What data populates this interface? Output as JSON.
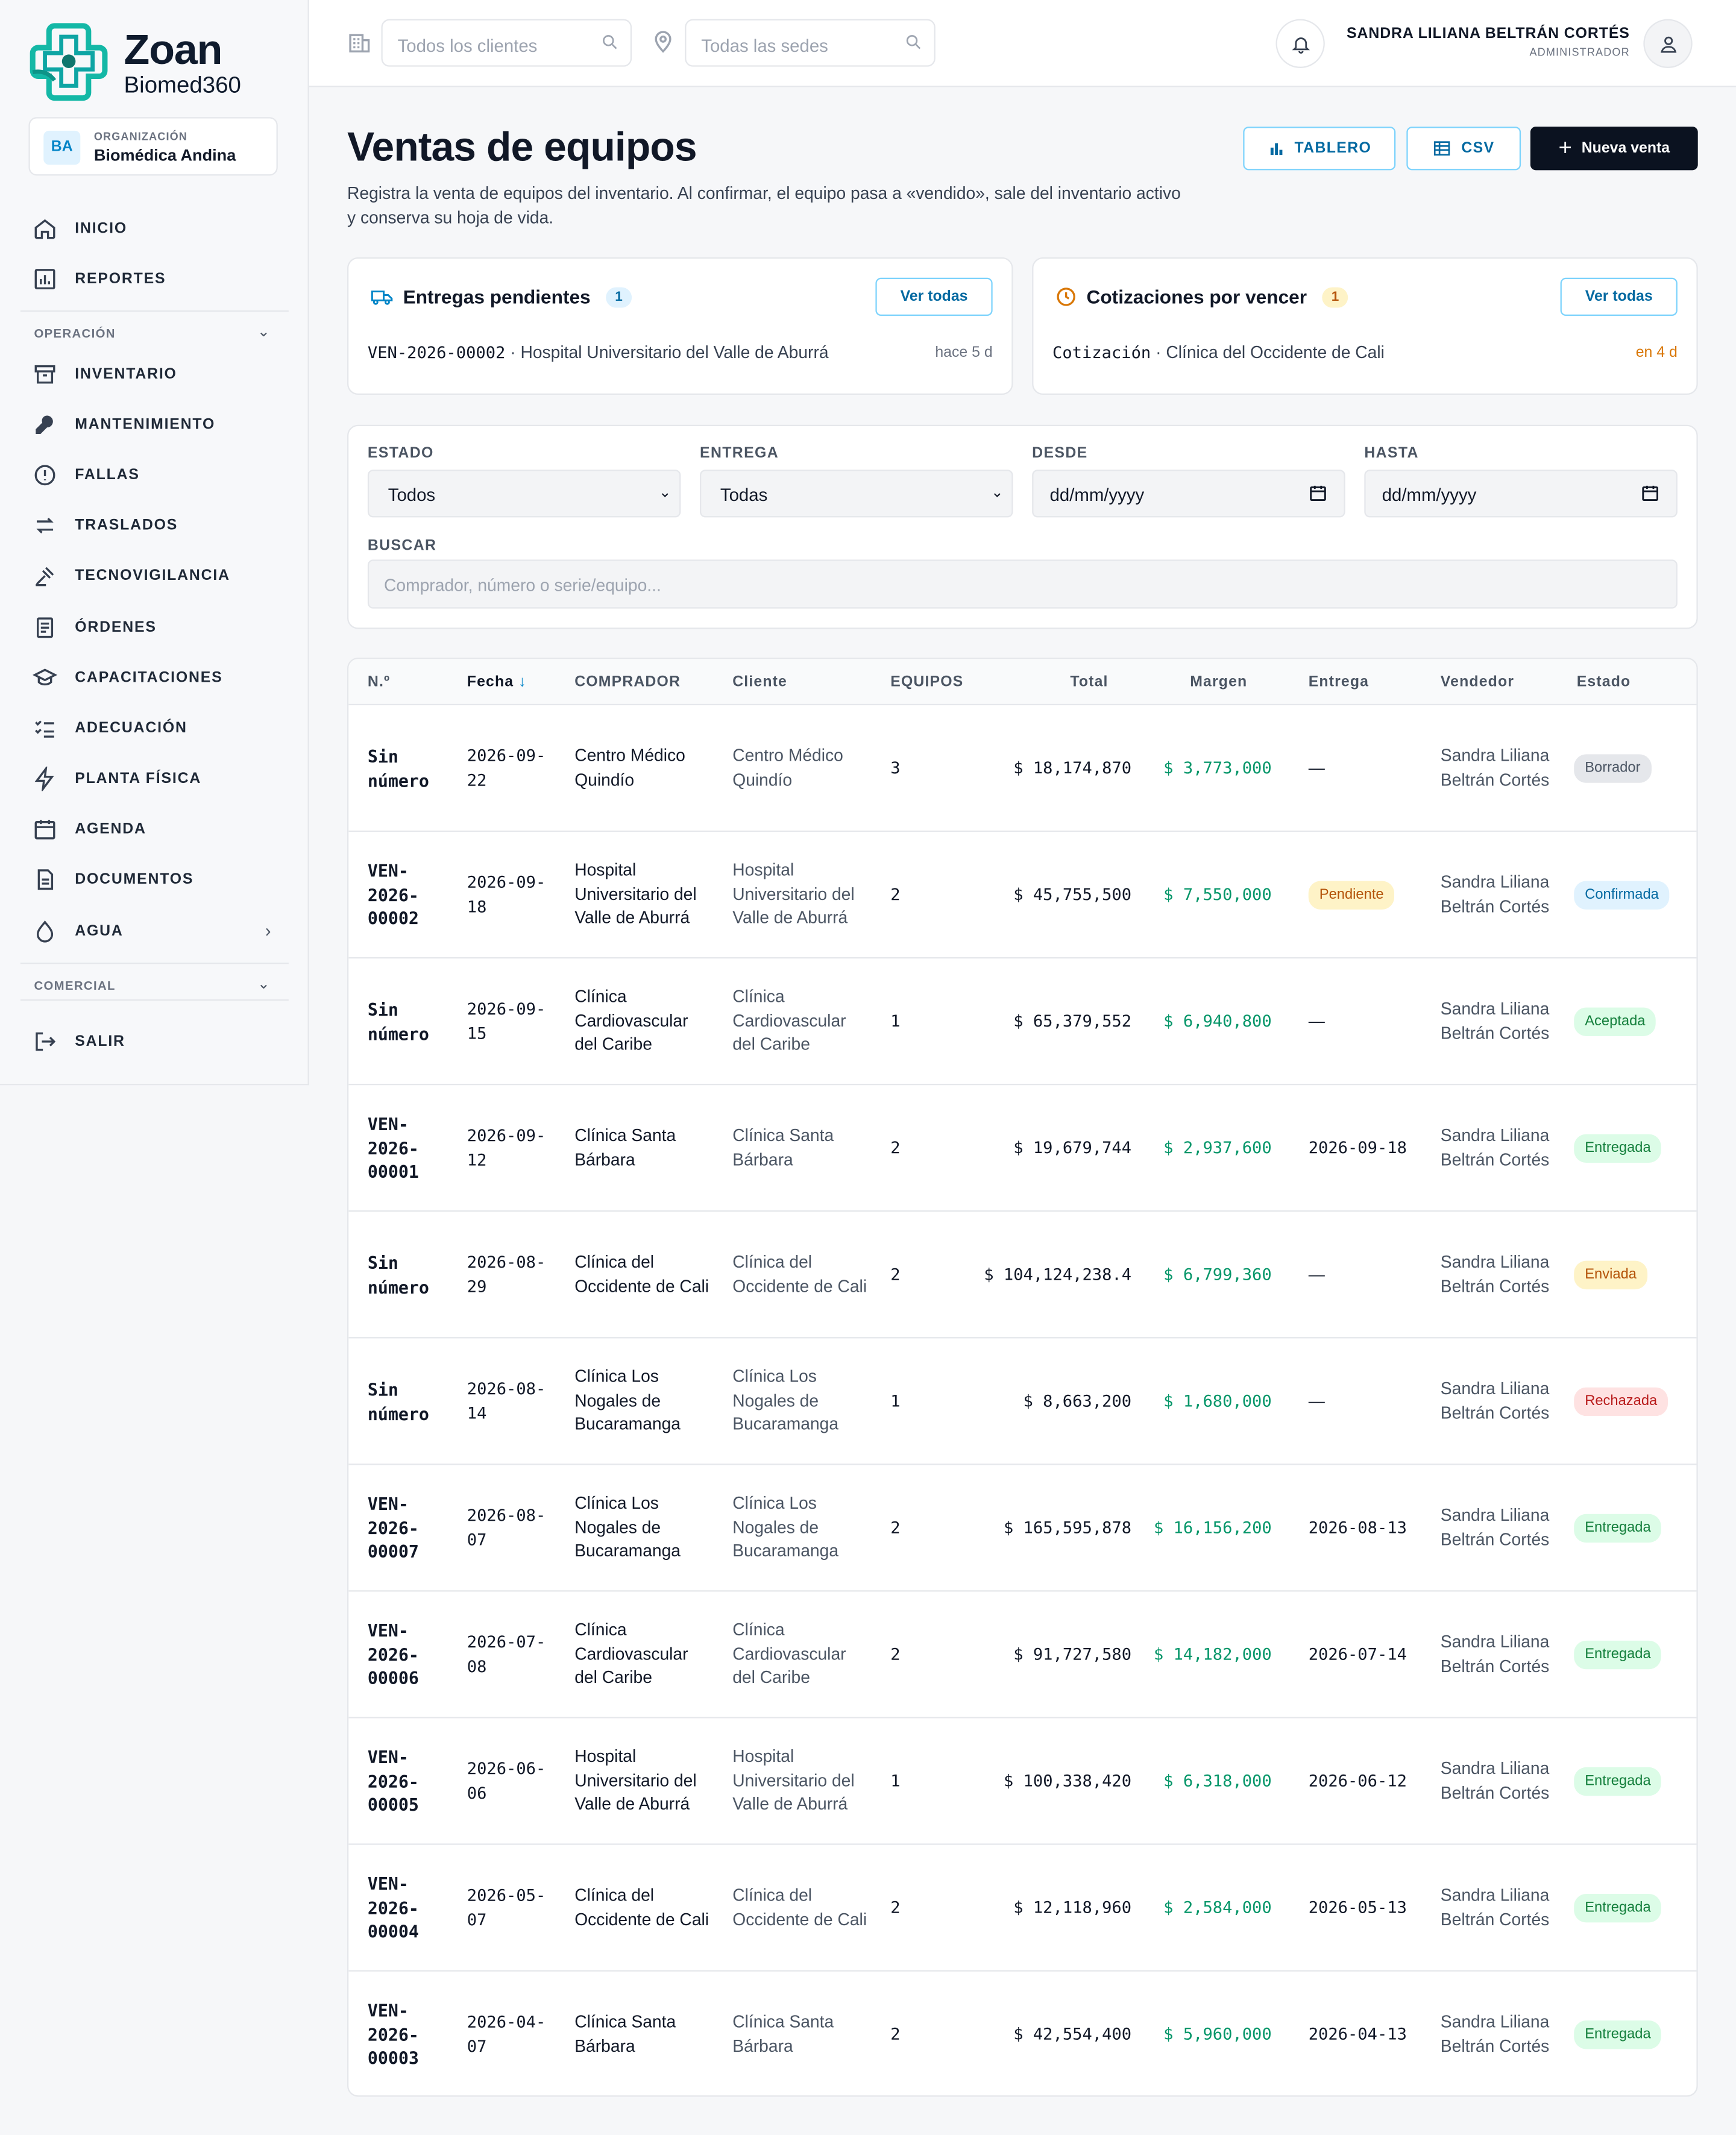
{
  "app": {
    "name": "Zoan",
    "subname": "Biomed360"
  },
  "org": {
    "badge": "BA",
    "label": "ORGANIZACIÓN",
    "name": "Biomédica Andina"
  },
  "nav": {
    "top": [
      {
        "label": "INICIO",
        "icon": "home-icon"
      },
      {
        "label": "REPORTES",
        "icon": "chart-icon"
      }
    ],
    "section_operacion": "OPERACIÓN",
    "operacion": [
      {
        "label": "INVENTARIO",
        "icon": "archive-icon"
      },
      {
        "label": "MANTENIMIENTO",
        "icon": "wrench-icon"
      },
      {
        "label": "FALLAS",
        "icon": "alert-icon"
      },
      {
        "label": "TRASLADOS",
        "icon": "transfer-icon"
      },
      {
        "label": "TECNOVIGILANCIA",
        "icon": "gavel-icon"
      },
      {
        "label": "ÓRDENES",
        "icon": "clipboard-icon"
      },
      {
        "label": "CAPACITACIONES",
        "icon": "graduation-icon"
      },
      {
        "label": "ADECUACIÓN",
        "icon": "checklist-icon"
      },
      {
        "label": "PLANTA FÍSICA",
        "icon": "bolt-icon"
      },
      {
        "label": "AGENDA",
        "icon": "calendar-icon"
      },
      {
        "label": "DOCUMENTOS",
        "icon": "document-icon"
      },
      {
        "label": "AGUA",
        "icon": "drop-icon"
      }
    ],
    "section_comercial": "COMERCIAL",
    "logout": "SALIR"
  },
  "topbar": {
    "clients_placeholder": "Todos los clientes",
    "sites_placeholder": "Todas las sedes",
    "user_name": "SANDRA LILIANA BELTRÁN CORTÉS",
    "user_role": "ADMINISTRADOR"
  },
  "page": {
    "title": "Ventas de equipos",
    "description": "Registra la venta de equipos del inventario. Al confirmar, el equipo pasa a «vendido», sale del inventario activo y conserva su hoja de vida.",
    "btn_tablero": "TABLERO",
    "btn_csv": "CSV",
    "btn_new": "Nueva venta"
  },
  "cards": {
    "entregas": {
      "title": "Entregas pendientes",
      "count": "1",
      "button": "Ver todas",
      "code": "VEN-2026-00002",
      "text": " · Hospital Universitario del Valle de Aburrá",
      "meta": "hace 5 d"
    },
    "cotizaciones": {
      "title": "Cotizaciones por vencer",
      "count": "1",
      "button": "Ver todas",
      "code": "Cotización",
      "text": " · Clínica del Occidente de Cali",
      "meta": "en 4 d"
    }
  },
  "filters": {
    "estado_label": "ESTADO",
    "estado_value": "Todos",
    "entrega_label": "ENTREGA",
    "entrega_value": "Todas",
    "desde_label": "DESDE",
    "desde_value": "dd/mm/yyyy",
    "hasta_label": "HASTA",
    "hasta_value": "dd/mm/yyyy",
    "buscar_label": "BUSCAR",
    "buscar_placeholder": "Comprador, número o serie/equipo..."
  },
  "table": {
    "headers": {
      "num": "N.º",
      "fecha": "Fecha",
      "comprador": "COMPRADOR",
      "cliente": "Cliente",
      "equipos": "EQUIPOS",
      "total": "Total",
      "margen": "Margen",
      "entrega": "Entrega",
      "vendedor": "Vendedor",
      "estado": "Estado"
    },
    "rows": [
      {
        "num": "Sin número",
        "fecha": "2026-09-22",
        "comprador": "Centro Médico Quindío",
        "cliente": "Centro Médico Quindío",
        "equipos": "3",
        "total": "$ 18,174,870",
        "margen": "$ 3,773,000",
        "entrega": "—",
        "vendedor": "Sandra Liliana Beltrán Cortés",
        "estado": "Borrador"
      },
      {
        "num": "VEN-2026-00002",
        "fecha": "2026-09-18",
        "comprador": "Hospital Universitario del Valle de Aburrá",
        "cliente": "Hospital Universitario del Valle de Aburrá",
        "equipos": "2",
        "total": "$ 45,755,500",
        "margen": "$ 7,550,000",
        "entrega": "Pendiente",
        "vendedor": "Sandra Liliana Beltrán Cortés",
        "estado": "Confirmada"
      },
      {
        "num": "Sin número",
        "fecha": "2026-09-15",
        "comprador": "Clínica Cardiovascular del Caribe",
        "cliente": "Clínica Cardiovascular del Caribe",
        "equipos": "1",
        "total": "$ 65,379,552",
        "margen": "$ 6,940,800",
        "entrega": "—",
        "vendedor": "Sandra Liliana Beltrán Cortés",
        "estado": "Aceptada"
      },
      {
        "num": "VEN-2026-00001",
        "fecha": "2026-09-12",
        "comprador": "Clínica Santa Bárbara",
        "cliente": "Clínica Santa Bárbara",
        "equipos": "2",
        "total": "$ 19,679,744",
        "margen": "$ 2,937,600",
        "entrega": "2026-09-18",
        "vendedor": "Sandra Liliana Beltrán Cortés",
        "estado": "Entregada"
      },
      {
        "num": "Sin número",
        "fecha": "2026-08-29",
        "comprador": "Clínica del Occidente de Cali",
        "cliente": "Clínica del Occidente de Cali",
        "equipos": "2",
        "total": "$ 104,124,238.4",
        "margen": "$ 6,799,360",
        "entrega": "—",
        "vendedor": "Sandra Liliana Beltrán Cortés",
        "estado": "Enviada"
      },
      {
        "num": "Sin número",
        "fecha": "2026-08-14",
        "comprador": "Clínica Los Nogales de Bucaramanga",
        "cliente": "Clínica Los Nogales de Bucaramanga",
        "equipos": "1",
        "total": "$ 8,663,200",
        "margen": "$ 1,680,000",
        "entrega": "—",
        "vendedor": "Sandra Liliana Beltrán Cortés",
        "estado": "Rechazada"
      },
      {
        "num": "VEN-2026-00007",
        "fecha": "2026-08-07",
        "comprador": "Clínica Los Nogales de Bucaramanga",
        "cliente": "Clínica Los Nogales de Bucaramanga",
        "equipos": "2",
        "total": "$ 165,595,878",
        "margen": "$ 16,156,200",
        "entrega": "2026-08-13",
        "vendedor": "Sandra Liliana Beltrán Cortés",
        "estado": "Entregada"
      },
      {
        "num": "VEN-2026-00006",
        "fecha": "2026-07-08",
        "comprador": "Clínica Cardiovascular del Caribe",
        "cliente": "Clínica Cardiovascular del Caribe",
        "equipos": "2",
        "total": "$ 91,727,580",
        "margen": "$ 14,182,000",
        "entrega": "2026-07-14",
        "vendedor": "Sandra Liliana Beltrán Cortés",
        "estado": "Entregada"
      },
      {
        "num": "VEN-2026-00005",
        "fecha": "2026-06-06",
        "comprador": "Hospital Universitario del Valle de Aburrá",
        "cliente": "Hospital Universitario del Valle de Aburrá",
        "equipos": "1",
        "total": "$ 100,338,420",
        "margen": "$ 6,318,000",
        "entrega": "2026-06-12",
        "vendedor": "Sandra Liliana Beltrán Cortés",
        "estado": "Entregada"
      },
      {
        "num": "VEN-2026-00004",
        "fecha": "2026-05-07",
        "comprador": "Clínica del Occidente de Cali",
        "cliente": "Clínica del Occidente de Cali",
        "equipos": "2",
        "total": "$ 12,118,960",
        "margen": "$ 2,584,000",
        "entrega": "2026-05-13",
        "vendedor": "Sandra Liliana Beltrán Cortés",
        "estado": "Entregada"
      },
      {
        "num": "VEN-2026-00003",
        "fecha": "2026-04-07",
        "comprador": "Clínica Santa Bárbara",
        "cliente": "Clínica Santa Bárbara",
        "equipos": "2",
        "total": "$ 42,554,400",
        "margen": "$ 5,960,000",
        "entrega": "2026-04-13",
        "vendedor": "Sandra Liliana Beltrán Cortés",
        "estado": "Entregada"
      }
    ]
  },
  "status_colors": {
    "Borrador": {
      "bg": "#e5e7eb",
      "fg": "#4b5563"
    },
    "Confirmada": {
      "bg": "#e0f2fe",
      "fg": "#0369a1"
    },
    "Aceptada": {
      "bg": "#dcfce7",
      "fg": "#15803d"
    },
    "Entregada": {
      "bg": "#dcfce7",
      "fg": "#15803d"
    },
    "Enviada": {
      "bg": "#fef3c7",
      "fg": "#b45309"
    },
    "Rechazada": {
      "bg": "#fee2e2",
      "fg": "#b91c1c"
    },
    "Pendiente": {
      "bg": "#fef3c7",
      "fg": "#b45309"
    }
  }
}
